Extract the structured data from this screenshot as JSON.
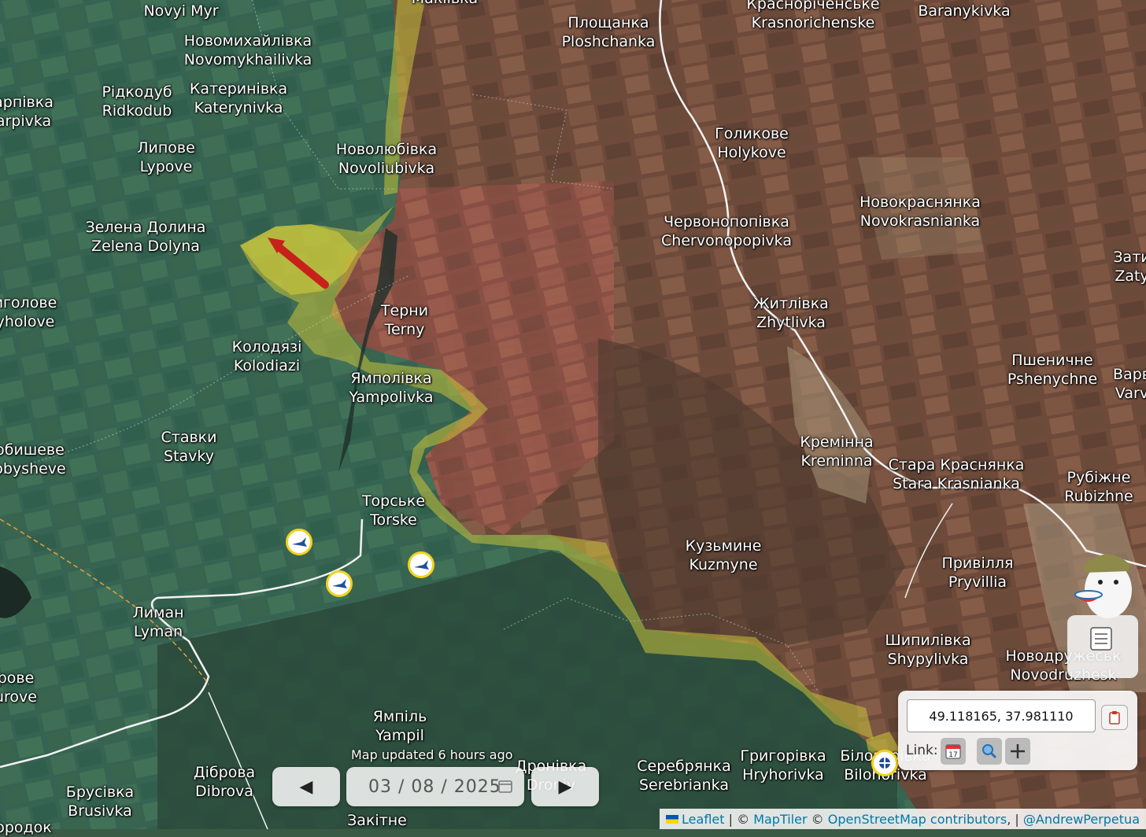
{
  "map": {
    "labels": [
      {
        "id": "novyi-myr",
        "lines": [
          "Novyi Myr"
        ]
      },
      {
        "id": "novomykhailivka",
        "lines": [
          "Новомихайлівка",
          "Novomykhailivka"
        ]
      },
      {
        "id": "ridkodub",
        "lines": [
          "Рідкодуб",
          "Ridkodub"
        ]
      },
      {
        "id": "katerynivka",
        "lines": [
          "Катеринівка",
          "Katerynivka"
        ]
      },
      {
        "id": "karpivka",
        "lines": [
          "арпівка",
          "arpivka"
        ]
      },
      {
        "id": "lypove",
        "lines": [
          "Липове",
          "Lypove"
        ]
      },
      {
        "id": "novoliubivka",
        "lines": [
          "Новолюбівка",
          "Novoliubivka"
        ]
      },
      {
        "id": "zelena-dolyna",
        "lines": [
          "Зелена Долина",
          "Zelena Dolyna"
        ]
      },
      {
        "id": "terny",
        "lines": [
          "Терни",
          "Terny"
        ]
      },
      {
        "id": "yahholove",
        "lines": [
          "иголове",
          "yholove"
        ]
      },
      {
        "id": "kolodiazi",
        "lines": [
          "Колодязі",
          "Kolodiazi"
        ]
      },
      {
        "id": "yampolivka",
        "lines": [
          "Ямполівка",
          "Yampolivka"
        ]
      },
      {
        "id": "stavky",
        "lines": [
          "Ставки",
          "Stavky"
        ]
      },
      {
        "id": "drobysheve",
        "lines": [
          "обишеве",
          "obysheve"
        ]
      },
      {
        "id": "torske",
        "lines": [
          "Торське",
          "Torske"
        ]
      },
      {
        "id": "lyman",
        "lines": [
          "Лиман",
          "Lyman"
        ]
      },
      {
        "id": "shandryholove",
        "lines": [
          "рове",
          "urove"
        ]
      },
      {
        "id": "yampil",
        "lines": [
          "Ямпіль",
          "Yampil"
        ]
      },
      {
        "id": "dibrova",
        "lines": [
          "Діброва",
          "Dibrova"
        ]
      },
      {
        "id": "brusivka",
        "lines": [
          "Брусівка",
          "Brusivka"
        ]
      },
      {
        "id": "zakitne",
        "lines": [
          "Закітне"
        ]
      },
      {
        "id": "dronivka",
        "lines": [
          "Дронівка",
          "Droniv"
        ]
      },
      {
        "id": "gorodok",
        "lines": [
          "ородок"
        ]
      },
      {
        "id": "makiivka",
        "lines": [
          "Макіївка"
        ]
      },
      {
        "id": "ploshchanka",
        "lines": [
          "Площанка",
          "Ploshchanka"
        ]
      },
      {
        "id": "krasnorichenske",
        "lines": [
          "Красноріченське",
          "Krasnorichenske"
        ]
      },
      {
        "id": "baranykivka",
        "lines": [
          "Baranykivka"
        ]
      },
      {
        "id": "holykove",
        "lines": [
          "Голикове",
          "Holykove"
        ]
      },
      {
        "id": "novokrasnianka",
        "lines": [
          "Новокраснянка",
          "Novokrasnianka"
        ]
      },
      {
        "id": "chervonopopivka",
        "lines": [
          "Червонопопівка",
          "Chervonopopivka"
        ]
      },
      {
        "id": "zatyshshia",
        "lines": [
          "Зати",
          "Zaty"
        ]
      },
      {
        "id": "zhytlivka",
        "lines": [
          "Житлівка",
          "Zhytlivka"
        ]
      },
      {
        "id": "pshenychne",
        "lines": [
          "Пшеничне",
          "Pshenychne"
        ]
      },
      {
        "id": "varvarivka",
        "lines": [
          "Варв",
          "Varv"
        ]
      },
      {
        "id": "kreminna",
        "lines": [
          "Кремінна",
          "Kreminna"
        ]
      },
      {
        "id": "stara-krasnianka",
        "lines": [
          "Стара Краснянка",
          "Stara Krasnianka"
        ]
      },
      {
        "id": "rubizhne",
        "lines": [
          "Рубіжне",
          "Rubizhne"
        ]
      },
      {
        "id": "kuzmyne",
        "lines": [
          "Кузьмине",
          "Kuzmyne"
        ]
      },
      {
        "id": "pryvillia",
        "lines": [
          "Привілля",
          "Pryvillia"
        ]
      },
      {
        "id": "shypylivka",
        "lines": [
          "Шипилівка",
          "Shypylivka"
        ]
      },
      {
        "id": "novodruzhesk",
        "lines": [
          "Новодружеськ",
          "Novodruzhesk"
        ]
      },
      {
        "id": "serebrianka",
        "lines": [
          "Серебрянка",
          "Serebrianka"
        ]
      },
      {
        "id": "hryhorivka",
        "lines": [
          "Григорівка",
          "Hryhorivka"
        ]
      },
      {
        "id": "bilohorivka",
        "lines": [
          "Білогорівка",
          "Bilohorivka"
        ]
      }
    ]
  },
  "status": {
    "updated_text": "Map updated 6 hours ago"
  },
  "timeline": {
    "date": "03 / 08 / 2025",
    "prev_symbol": "◀",
    "next_symbol": "▶"
  },
  "coords": {
    "value": "49.118165, 37.981110",
    "link_label": "Link:"
  },
  "attribution": {
    "leaflet": "Leaflet",
    "sep1": " | © ",
    "maptiler": "MapTiler",
    "copy": " © ",
    "osm": "OpenStreetMap contributors",
    "sep2": ", | ",
    "author": "@AndrewPerpetua"
  },
  "colors": {
    "ua_controlled": "#2e5e52",
    "ru_controlled": "#8a4f3c",
    "contested": "#c9c33a",
    "advance_arrow": "#c8211b",
    "marker_border": "#f2d21b"
  },
  "icons": {
    "unit_marker": "aircraft-icon",
    "copy": "clipboard-icon",
    "calendar": "calendar-icon",
    "zoom": "magnifier-icon",
    "crosshair": "crosshair-icon"
  }
}
